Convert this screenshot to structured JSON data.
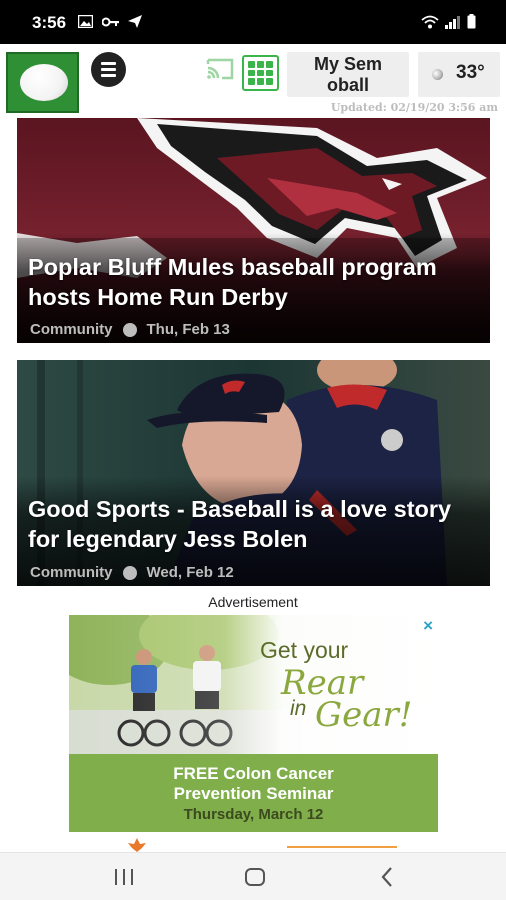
{
  "status_bar": {
    "time": "3:56",
    "icons_left": [
      "image-icon",
      "key-icon",
      "send-icon"
    ],
    "icons_right": [
      "wifi-icon",
      "signal-icon",
      "battery-icon"
    ]
  },
  "header": {
    "my_app_label": "My Sem\noball",
    "temperature": "33°",
    "updated": "Updated: 02/19/20 3:56 am"
  },
  "articles": [
    {
      "title": "Poplar Bluff Mules baseball program hosts Home Run Derby",
      "category": "Community",
      "date": "Thu, Feb 13"
    },
    {
      "title": "Good Sports - Baseball is a love story for legendary Jess Bolen",
      "category": "Community",
      "date": "Wed, Feb 12"
    }
  ],
  "ad": {
    "label": "Advertisement",
    "close": "×",
    "get_your": "Get your",
    "rear": "Rear",
    "in": "in",
    "gear": "Gear!",
    "free_line1": "FREE Colon Cancer",
    "free_line2": "Prevention Seminar",
    "date": "Thursday, March 12"
  },
  "colors": {
    "brand_green": "#39b54a",
    "logo_green": "#2f8f35",
    "ad_green": "#7fae4a",
    "maroon": "#6e1a24"
  }
}
